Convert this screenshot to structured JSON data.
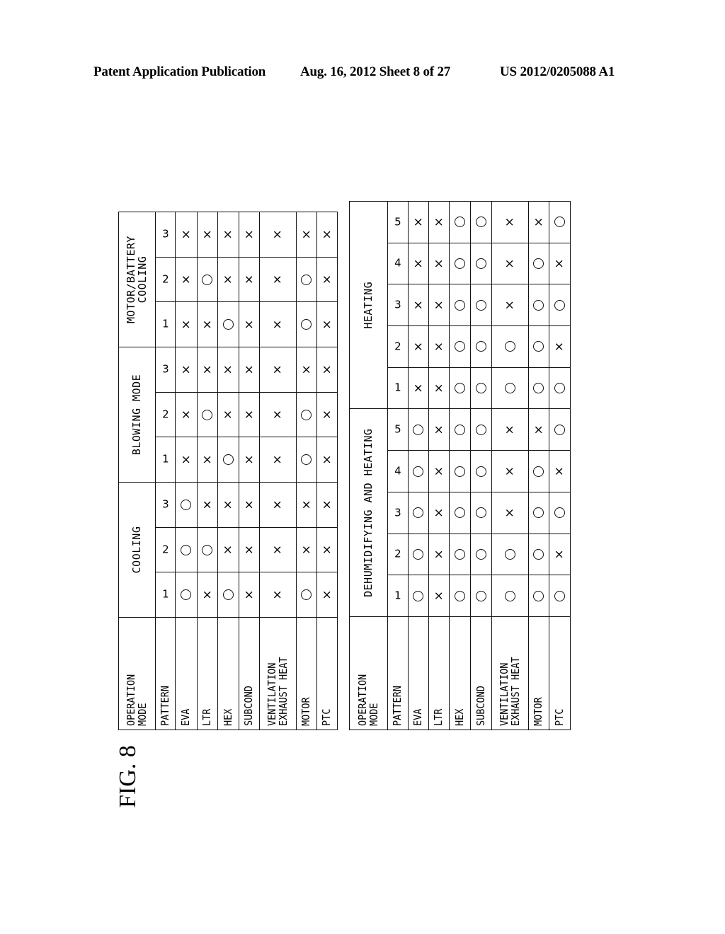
{
  "header": {
    "left": "Patent Application Publication",
    "middle": "Aug. 16, 2012  Sheet 8 of 27",
    "right": "US 2012/0205088 A1"
  },
  "figure_label": "FIG. 8",
  "row_labels": [
    "OPERATION MODE",
    "PATTERN",
    "EVA",
    "LTR",
    "HEX",
    "SUBCOND",
    "VENTILATION EXHAUST HEAT",
    "MOTOR",
    "PTC"
  ],
  "row_labels_display": {
    "operation_mode": [
      "OPERATION",
      "MODE"
    ],
    "ventilation": [
      "VENTILATION",
      "EXHAUST HEAT"
    ]
  },
  "symbols": {
    "on": "○",
    "off": "×"
  },
  "tables": [
    {
      "modes": [
        {
          "name": "COOLING",
          "patterns": [
            {
              "pattern": "1",
              "EVA": "O",
              "LTR": "X",
              "HEX": "O",
              "SUBCOND": "X",
              "VENTILATION EXHAUST HEAT": "X",
              "MOTOR": "O",
              "PTC": "X"
            },
            {
              "pattern": "2",
              "EVA": "O",
              "LTR": "O",
              "HEX": "X",
              "SUBCOND": "X",
              "VENTILATION EXHAUST HEAT": "X",
              "MOTOR": "X",
              "PTC": "X"
            },
            {
              "pattern": "3",
              "EVA": "O",
              "LTR": "X",
              "HEX": "X",
              "SUBCOND": "X",
              "VENTILATION EXHAUST HEAT": "X",
              "MOTOR": "X",
              "PTC": "X"
            }
          ]
        },
        {
          "name": "BLOWING MODE",
          "patterns": [
            {
              "pattern": "1",
              "EVA": "X",
              "LTR": "X",
              "HEX": "O",
              "SUBCOND": "X",
              "VENTILATION EXHAUST HEAT": "X",
              "MOTOR": "O",
              "PTC": "X"
            },
            {
              "pattern": "2",
              "EVA": "X",
              "LTR": "O",
              "HEX": "X",
              "SUBCOND": "X",
              "VENTILATION EXHAUST HEAT": "X",
              "MOTOR": "O",
              "PTC": "X"
            },
            {
              "pattern": "3",
              "EVA": "X",
              "LTR": "X",
              "HEX": "X",
              "SUBCOND": "X",
              "VENTILATION EXHAUST HEAT": "X",
              "MOTOR": "X",
              "PTC": "X"
            }
          ]
        },
        {
          "name": "MOTOR/BATTERY COOLING",
          "name_lines": [
            "MOTOR/BATTERY",
            "COOLING"
          ],
          "patterns": [
            {
              "pattern": "1",
              "EVA": "X",
              "LTR": "X",
              "HEX": "O",
              "SUBCOND": "X",
              "VENTILATION EXHAUST HEAT": "X",
              "MOTOR": "O",
              "PTC": "X"
            },
            {
              "pattern": "2",
              "EVA": "X",
              "LTR": "O",
              "HEX": "X",
              "SUBCOND": "X",
              "VENTILATION EXHAUST HEAT": "X",
              "MOTOR": "O",
              "PTC": "X"
            },
            {
              "pattern": "3",
              "EVA": "X",
              "LTR": "X",
              "HEX": "X",
              "SUBCOND": "X",
              "VENTILATION EXHAUST HEAT": "X",
              "MOTOR": "X",
              "PTC": "X"
            }
          ]
        }
      ]
    },
    {
      "modes": [
        {
          "name": "DEHUMIDIFYING AND HEATING",
          "patterns": [
            {
              "pattern": "1",
              "EVA": "O",
              "LTR": "X",
              "HEX": "O",
              "SUBCOND": "O",
              "VENTILATION EXHAUST HEAT": "O",
              "MOTOR": "O",
              "PTC": "O"
            },
            {
              "pattern": "2",
              "EVA": "O",
              "LTR": "X",
              "HEX": "O",
              "SUBCOND": "O",
              "VENTILATION EXHAUST HEAT": "O",
              "MOTOR": "O",
              "PTC": "X"
            },
            {
              "pattern": "3",
              "EVA": "O",
              "LTR": "X",
              "HEX": "O",
              "SUBCOND": "O",
              "VENTILATION EXHAUST HEAT": "X",
              "MOTOR": "O",
              "PTC": "O"
            },
            {
              "pattern": "4",
              "EVA": "O",
              "LTR": "X",
              "HEX": "O",
              "SUBCOND": "O",
              "VENTILATION EXHAUST HEAT": "X",
              "MOTOR": "O",
              "PTC": "X"
            },
            {
              "pattern": "5",
              "EVA": "O",
              "LTR": "X",
              "HEX": "O",
              "SUBCOND": "O",
              "VENTILATION EXHAUST HEAT": "X",
              "MOTOR": "X",
              "PTC": "O"
            }
          ]
        },
        {
          "name": "HEATING",
          "patterns": [
            {
              "pattern": "1",
              "EVA": "X",
              "LTR": "X",
              "HEX": "O",
              "SUBCOND": "O",
              "VENTILATION EXHAUST HEAT": "O",
              "MOTOR": "O",
              "PTC": "O"
            },
            {
              "pattern": "2",
              "EVA": "X",
              "LTR": "X",
              "HEX": "O",
              "SUBCOND": "O",
              "VENTILATION EXHAUST HEAT": "O",
              "MOTOR": "O",
              "PTC": "X"
            },
            {
              "pattern": "3",
              "EVA": "X",
              "LTR": "X",
              "HEX": "O",
              "SUBCOND": "O",
              "VENTILATION EXHAUST HEAT": "X",
              "MOTOR": "O",
              "PTC": "O"
            },
            {
              "pattern": "4",
              "EVA": "X",
              "LTR": "X",
              "HEX": "O",
              "SUBCOND": "O",
              "VENTILATION EXHAUST HEAT": "X",
              "MOTOR": "O",
              "PTC": "X"
            },
            {
              "pattern": "5",
              "EVA": "X",
              "LTR": "X",
              "HEX": "O",
              "SUBCOND": "O",
              "VENTILATION EXHAUST HEAT": "X",
              "MOTOR": "X",
              "PTC": "O"
            }
          ]
        }
      ]
    }
  ]
}
